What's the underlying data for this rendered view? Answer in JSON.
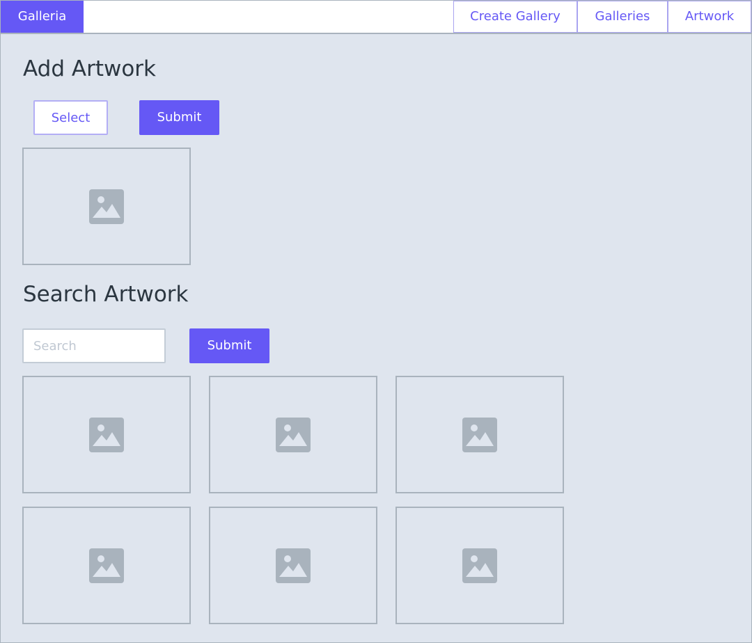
{
  "brand": {
    "label": "Galleria"
  },
  "nav": {
    "create_gallery": "Create Gallery",
    "galleries": "Galleries",
    "artwork": "Artwork"
  },
  "add_section": {
    "title": "Add Artwork",
    "select_label": "Select",
    "submit_label": "Submit",
    "preview_icon": "image-placeholder-icon"
  },
  "search_section": {
    "title": "Search Artwork",
    "search_placeholder": "Search",
    "search_value": "",
    "submit_label": "Submit",
    "results": [
      {
        "icon": "image-placeholder-icon"
      },
      {
        "icon": "image-placeholder-icon"
      },
      {
        "icon": "image-placeholder-icon"
      },
      {
        "icon": "image-placeholder-icon"
      },
      {
        "icon": "image-placeholder-icon"
      },
      {
        "icon": "image-placeholder-icon"
      }
    ]
  },
  "colors": {
    "accent": "#6558f5",
    "background": "#dfe5ee",
    "border": "#a9b3bd",
    "icon": "#a9b3bd"
  }
}
